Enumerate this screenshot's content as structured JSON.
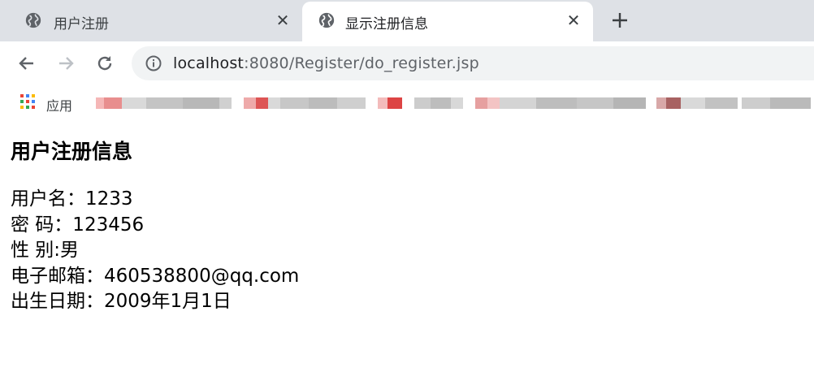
{
  "tabs": [
    {
      "title": "用户注册",
      "icon": "globe-icon",
      "active": false
    },
    {
      "title": "显示注册信息",
      "icon": "globe-icon",
      "active": true
    }
  ],
  "toolbar": {
    "url_host": "localhost",
    "url_rest": ":8080/Register/do_register.jsp"
  },
  "bookmarks": {
    "apps_label": "应用"
  },
  "page": {
    "heading": "用户注册信息",
    "lines": [
      "用户名：1233",
      "密 码：123456",
      "性 别:男",
      "电子邮箱：460538800@qq.com",
      "出生日期：2009年1月1日"
    ]
  },
  "colors": {
    "tabstrip": "#dee1e6",
    "omnibox": "#f1f3f4",
    "icon": "#5f6368"
  }
}
